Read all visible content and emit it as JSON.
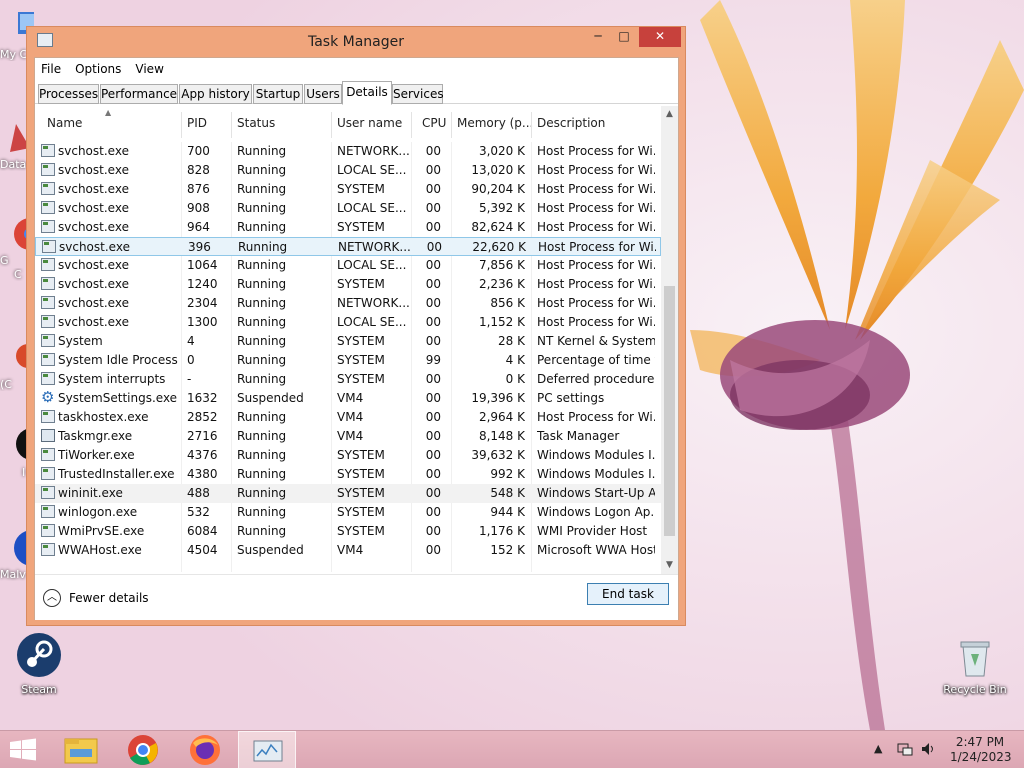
{
  "desktop": {
    "icons": [
      {
        "label": "Steam",
        "icon": "steam-icon"
      },
      {
        "label": "Recycle Bin",
        "icon": "recycle-bin-icon"
      }
    ],
    "edge_labels": [
      "My C",
      "Data",
      "G",
      "C",
      "(C",
      "I",
      "Malv"
    ]
  },
  "window": {
    "title": "Task Manager",
    "controls": {
      "minimize": "─",
      "maximize": "□",
      "close": "✕"
    },
    "menu": [
      "File",
      "Options",
      "View"
    ],
    "tabs": [
      "Processes",
      "Performance",
      "App history",
      "Startup",
      "Users",
      "Details",
      "Services"
    ],
    "active_tab": "Details",
    "columns": [
      "Name",
      "PID",
      "Status",
      "User name",
      "CPU",
      "Memory (p...",
      "Description"
    ],
    "rows": [
      {
        "name": "svchost.exe",
        "pid": "700",
        "status": "Running",
        "user": "NETWORK...",
        "cpu": "00",
        "mem": "3,020 K",
        "desc": "Host Process for Wi...",
        "icon": "exe"
      },
      {
        "name": "svchost.exe",
        "pid": "828",
        "status": "Running",
        "user": "LOCAL SE...",
        "cpu": "00",
        "mem": "13,020 K",
        "desc": "Host Process for Wi...",
        "icon": "exe"
      },
      {
        "name": "svchost.exe",
        "pid": "876",
        "status": "Running",
        "user": "SYSTEM",
        "cpu": "00",
        "mem": "90,204 K",
        "desc": "Host Process for Wi...",
        "icon": "exe"
      },
      {
        "name": "svchost.exe",
        "pid": "908",
        "status": "Running",
        "user": "LOCAL SE...",
        "cpu": "00",
        "mem": "5,392 K",
        "desc": "Host Process for Wi...",
        "icon": "exe"
      },
      {
        "name": "svchost.exe",
        "pid": "964",
        "status": "Running",
        "user": "SYSTEM",
        "cpu": "00",
        "mem": "82,624 K",
        "desc": "Host Process for Wi...",
        "icon": "exe"
      },
      {
        "name": "svchost.exe",
        "pid": "396",
        "status": "Running",
        "user": "NETWORK...",
        "cpu": "00",
        "mem": "22,620 K",
        "desc": "Host Process for Wi...",
        "icon": "exe",
        "selected": true
      },
      {
        "name": "svchost.exe",
        "pid": "1064",
        "status": "Running",
        "user": "LOCAL SE...",
        "cpu": "00",
        "mem": "7,856 K",
        "desc": "Host Process for Wi...",
        "icon": "exe"
      },
      {
        "name": "svchost.exe",
        "pid": "1240",
        "status": "Running",
        "user": "SYSTEM",
        "cpu": "00",
        "mem": "2,236 K",
        "desc": "Host Process for Wi...",
        "icon": "exe"
      },
      {
        "name": "svchost.exe",
        "pid": "2304",
        "status": "Running",
        "user": "NETWORK...",
        "cpu": "00",
        "mem": "856 K",
        "desc": "Host Process for Wi...",
        "icon": "exe"
      },
      {
        "name": "svchost.exe",
        "pid": "1300",
        "status": "Running",
        "user": "LOCAL SE...",
        "cpu": "00",
        "mem": "1,152 K",
        "desc": "Host Process for Wi...",
        "icon": "exe"
      },
      {
        "name": "System",
        "pid": "4",
        "status": "Running",
        "user": "SYSTEM",
        "cpu": "00",
        "mem": "28 K",
        "desc": "NT Kernel & System",
        "icon": "exe"
      },
      {
        "name": "System Idle Process",
        "pid": "0",
        "status": "Running",
        "user": "SYSTEM",
        "cpu": "99",
        "mem": "4 K",
        "desc": "Percentage of time t...",
        "icon": "exe"
      },
      {
        "name": "System interrupts",
        "pid": "-",
        "status": "Running",
        "user": "SYSTEM",
        "cpu": "00",
        "mem": "0 K",
        "desc": "Deferred procedure ...",
        "icon": "exe"
      },
      {
        "name": "SystemSettings.exe",
        "pid": "1632",
        "status": "Suspended",
        "user": "VM4",
        "cpu": "00",
        "mem": "19,396 K",
        "desc": "PC settings",
        "icon": "gear"
      },
      {
        "name": "taskhostex.exe",
        "pid": "2852",
        "status": "Running",
        "user": "VM4",
        "cpu": "00",
        "mem": "2,964 K",
        "desc": "Host Process for Wi...",
        "icon": "exe"
      },
      {
        "name": "Taskmgr.exe",
        "pid": "2716",
        "status": "Running",
        "user": "VM4",
        "cpu": "00",
        "mem": "8,148 K",
        "desc": "Task Manager",
        "icon": "monitor"
      },
      {
        "name": "TiWorker.exe",
        "pid": "4376",
        "status": "Running",
        "user": "SYSTEM",
        "cpu": "00",
        "mem": "39,632 K",
        "desc": "Windows Modules I...",
        "icon": "exe"
      },
      {
        "name": "TrustedInstaller.exe",
        "pid": "4380",
        "status": "Running",
        "user": "SYSTEM",
        "cpu": "00",
        "mem": "992 K",
        "desc": "Windows Modules I...",
        "icon": "exe"
      },
      {
        "name": "wininit.exe",
        "pid": "488",
        "status": "Running",
        "user": "SYSTEM",
        "cpu": "00",
        "mem": "548 K",
        "desc": "Windows Start-Up A...",
        "icon": "exe",
        "hover": true
      },
      {
        "name": "winlogon.exe",
        "pid": "532",
        "status": "Running",
        "user": "SYSTEM",
        "cpu": "00",
        "mem": "944 K",
        "desc": "Windows Logon Ap...",
        "icon": "exe"
      },
      {
        "name": "WmiPrvSE.exe",
        "pid": "6084",
        "status": "Running",
        "user": "SYSTEM",
        "cpu": "00",
        "mem": "1,176 K",
        "desc": "WMI Provider Host",
        "icon": "exe"
      },
      {
        "name": "WWAHost.exe",
        "pid": "4504",
        "status": "Suspended",
        "user": "VM4",
        "cpu": "00",
        "mem": "152 K",
        "desc": "Microsoft WWA Host",
        "icon": "exe"
      }
    ],
    "footer": {
      "fewer_details": "Fewer details",
      "end_task": "End task"
    }
  },
  "taskbar": {
    "items": [
      "start-icon",
      "file-explorer-icon",
      "chrome-icon",
      "firefox-icon",
      "task-manager-icon"
    ],
    "clock_time": "2:47 PM",
    "clock_date": "1/24/2023"
  },
  "colors": {
    "window_frame": "#f0a57c",
    "close_button": "#c7413c",
    "selected_row": "#e8f3fa",
    "taskbar": "#dca7b4"
  }
}
